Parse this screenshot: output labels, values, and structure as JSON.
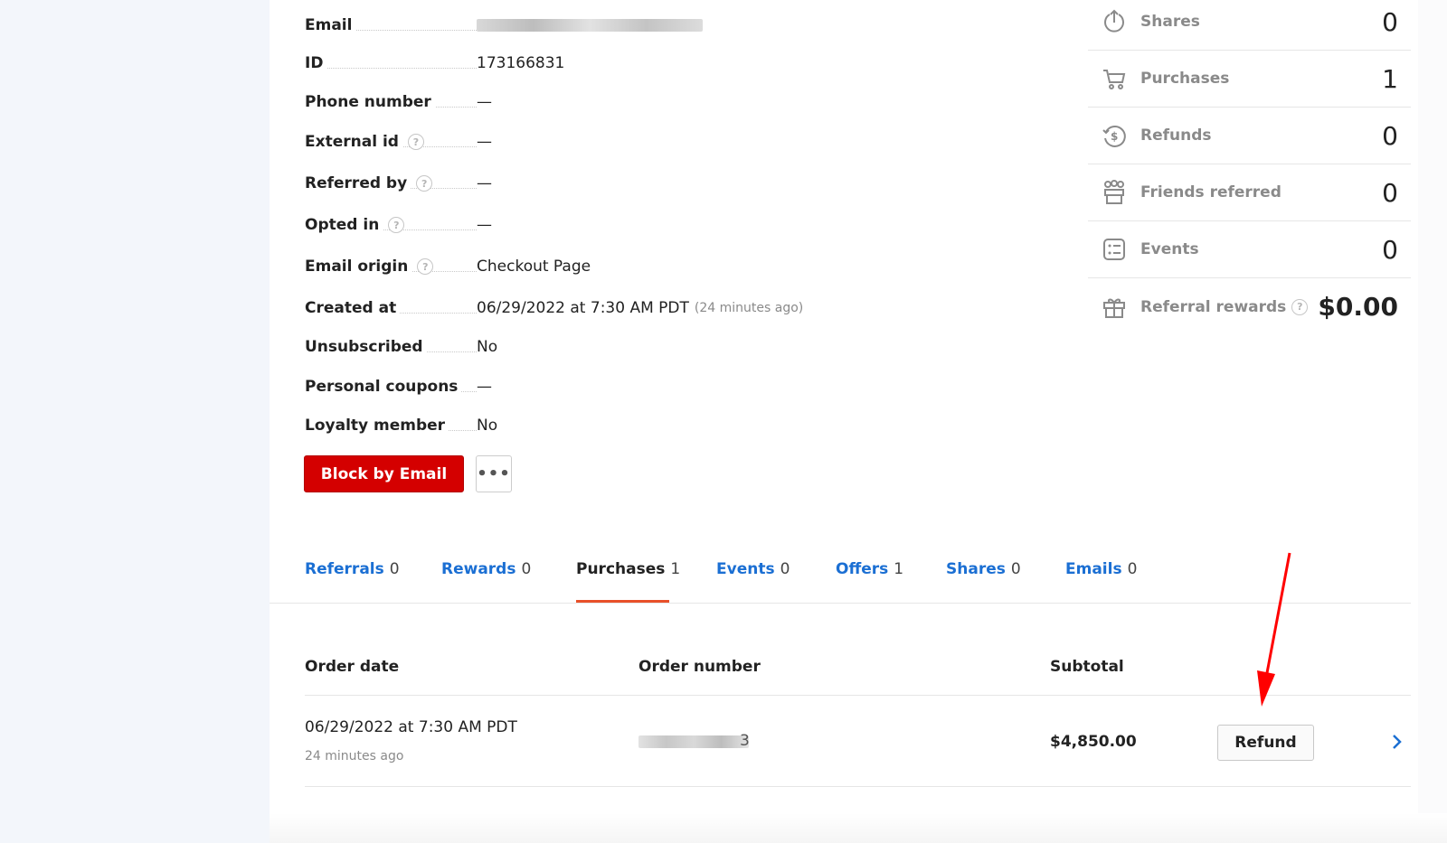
{
  "details": [
    {
      "label": "Email",
      "value": "",
      "help": false,
      "blurred": true
    },
    {
      "label": "ID",
      "value": "173166831",
      "help": false
    },
    {
      "label": "Phone number",
      "value": "—",
      "help": false
    },
    {
      "label": "External id",
      "value": "—",
      "help": true
    },
    {
      "label": "Referred by",
      "value": "—",
      "help": true
    },
    {
      "label": "Opted in",
      "value": "—",
      "help": true
    },
    {
      "label": "Email origin",
      "value": "Checkout Page",
      "help": true
    },
    {
      "label": "Created at",
      "value": "06/29/2022 at 7:30 AM PDT",
      "note": "(24 minutes ago)",
      "help": false
    },
    {
      "label": "Unsubscribed",
      "value": "No",
      "help": false
    },
    {
      "label": "Personal coupons",
      "value": "—",
      "help": false
    },
    {
      "label": "Loyalty member",
      "value": "No",
      "help": false
    }
  ],
  "help_glyph": "?",
  "actions": {
    "block_label": "Block by Email",
    "more_label": "•••"
  },
  "stats": [
    {
      "icon": "share-icon",
      "label": "Shares",
      "value": "0"
    },
    {
      "icon": "cart-icon",
      "label": "Purchases",
      "value": "1"
    },
    {
      "icon": "refund-icon",
      "label": "Refunds",
      "value": "0"
    },
    {
      "icon": "friends-icon",
      "label": "Friends referred",
      "value": "0"
    },
    {
      "icon": "events-icon",
      "label": "Events",
      "value": "0"
    },
    {
      "icon": "gift-icon",
      "label": "Referral rewards",
      "value": "$0.00",
      "help": true
    }
  ],
  "tabs": [
    {
      "label": "Referrals",
      "count": "0"
    },
    {
      "label": "Rewards",
      "count": "0"
    },
    {
      "label": "Purchases",
      "count": "1",
      "active": true
    },
    {
      "label": "Events",
      "count": "0"
    },
    {
      "label": "Offers",
      "count": "1"
    },
    {
      "label": "Shares",
      "count": "0"
    },
    {
      "label": "Emails",
      "count": "0"
    }
  ],
  "table": {
    "headers": {
      "order_date": "Order date",
      "order_number": "Order number",
      "subtotal": "Subtotal"
    },
    "rows": [
      {
        "order_date": "06/29/2022 at 7:30 AM PDT",
        "order_date_relative": "24 minutes ago",
        "order_number": "3",
        "subtotal": "$4,850.00",
        "action": "Refund"
      }
    ]
  },
  "colors": {
    "accent_blue": "#1b6fd3",
    "danger_red": "#d40000",
    "tab_underline": "#e8502a",
    "annotation_arrow": "#ff0000"
  }
}
